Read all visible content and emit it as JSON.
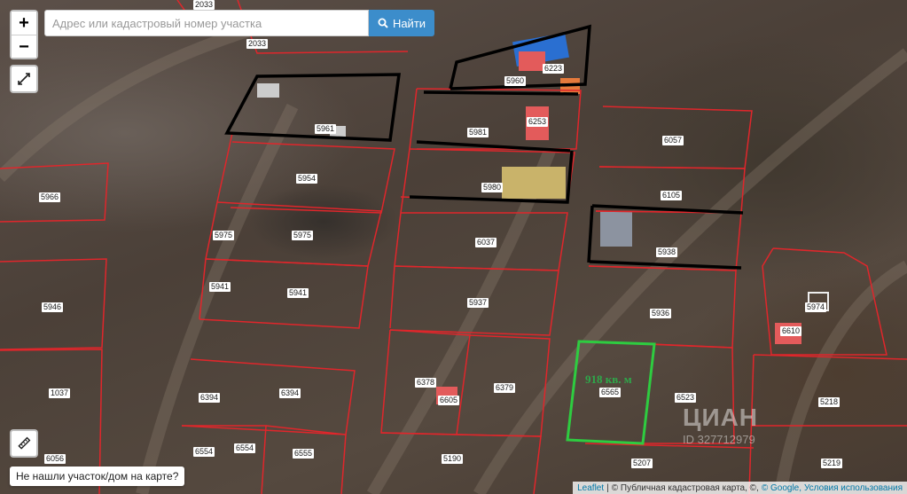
{
  "search": {
    "placeholder": "Адрес или кадастровый номер участка",
    "button_label": "Найти"
  },
  "zoom": {
    "in_label": "+",
    "out_label": "−"
  },
  "not_found_label": "Не нашли участок/дом на карте?",
  "selected_plot": {
    "area_label": "918 кв. м",
    "number": "6565"
  },
  "plots": [
    "2033",
    "2033",
    "6223",
    "5960",
    "5961",
    "5981",
    "6253",
    "6057",
    "5966",
    "5954",
    "5980",
    "6105",
    "5975",
    "5975",
    "6037",
    "5938",
    "5941",
    "5941",
    "5946",
    "5937",
    "5936",
    "5974",
    "6610",
    "1037",
    "6394",
    "6394",
    "6378",
    "6605",
    "6379",
    "6523",
    "5218",
    "6554",
    "6554",
    "6555",
    "5190",
    "5207",
    "5219",
    "6056"
  ],
  "watermark": {
    "brand": "ЦИАН",
    "id": "ID 327712979"
  },
  "attribution": {
    "leaflet": "Leaflet",
    "sep": "|",
    "source": "© Публичная кадастровая карта, ©,",
    "google": "© Google,",
    "terms": "Условия использования"
  },
  "colors": {
    "parcel_line": "#e0262b",
    "fence_line": "#000000",
    "selected_outline": "#2ecc40",
    "button_blue": "#3c8dcb"
  },
  "icons": [
    "search-icon",
    "fullscreen-icon",
    "ruler-icon"
  ]
}
